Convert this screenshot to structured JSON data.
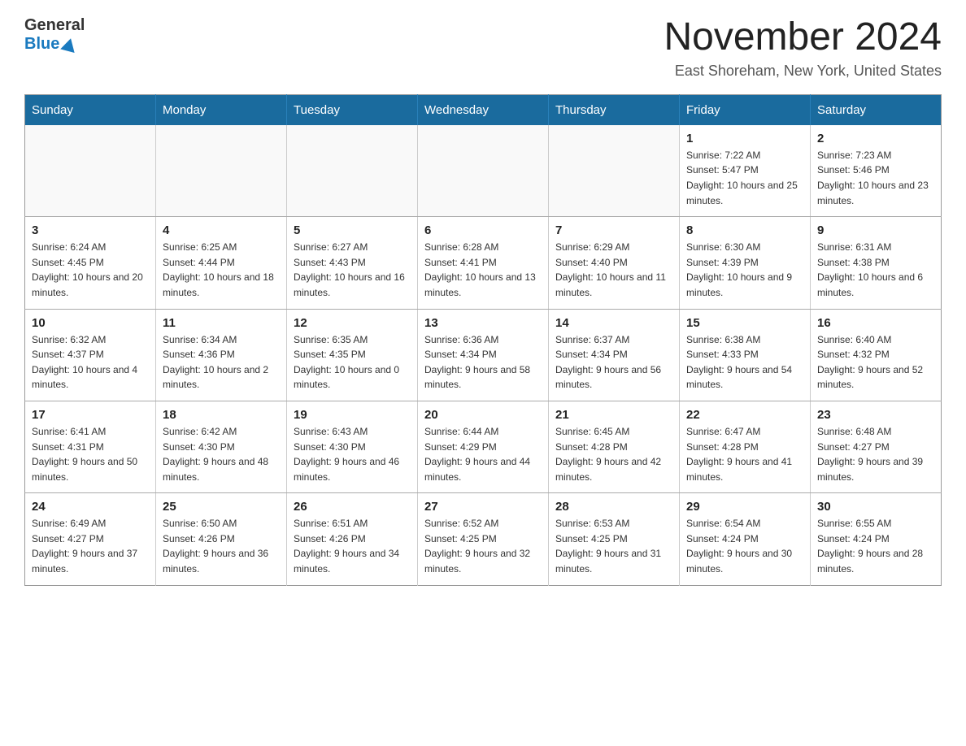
{
  "header": {
    "logo_general": "General",
    "logo_blue": "Blue",
    "month_title": "November 2024",
    "location": "East Shoreham, New York, United States"
  },
  "days_of_week": [
    "Sunday",
    "Monday",
    "Tuesday",
    "Wednesday",
    "Thursday",
    "Friday",
    "Saturday"
  ],
  "weeks": [
    [
      {
        "day": "",
        "info": ""
      },
      {
        "day": "",
        "info": ""
      },
      {
        "day": "",
        "info": ""
      },
      {
        "day": "",
        "info": ""
      },
      {
        "day": "",
        "info": ""
      },
      {
        "day": "1",
        "info": "Sunrise: 7:22 AM\nSunset: 5:47 PM\nDaylight: 10 hours and 25 minutes."
      },
      {
        "day": "2",
        "info": "Sunrise: 7:23 AM\nSunset: 5:46 PM\nDaylight: 10 hours and 23 minutes."
      }
    ],
    [
      {
        "day": "3",
        "info": "Sunrise: 6:24 AM\nSunset: 4:45 PM\nDaylight: 10 hours and 20 minutes."
      },
      {
        "day": "4",
        "info": "Sunrise: 6:25 AM\nSunset: 4:44 PM\nDaylight: 10 hours and 18 minutes."
      },
      {
        "day": "5",
        "info": "Sunrise: 6:27 AM\nSunset: 4:43 PM\nDaylight: 10 hours and 16 minutes."
      },
      {
        "day": "6",
        "info": "Sunrise: 6:28 AM\nSunset: 4:41 PM\nDaylight: 10 hours and 13 minutes."
      },
      {
        "day": "7",
        "info": "Sunrise: 6:29 AM\nSunset: 4:40 PM\nDaylight: 10 hours and 11 minutes."
      },
      {
        "day": "8",
        "info": "Sunrise: 6:30 AM\nSunset: 4:39 PM\nDaylight: 10 hours and 9 minutes."
      },
      {
        "day": "9",
        "info": "Sunrise: 6:31 AM\nSunset: 4:38 PM\nDaylight: 10 hours and 6 minutes."
      }
    ],
    [
      {
        "day": "10",
        "info": "Sunrise: 6:32 AM\nSunset: 4:37 PM\nDaylight: 10 hours and 4 minutes."
      },
      {
        "day": "11",
        "info": "Sunrise: 6:34 AM\nSunset: 4:36 PM\nDaylight: 10 hours and 2 minutes."
      },
      {
        "day": "12",
        "info": "Sunrise: 6:35 AM\nSunset: 4:35 PM\nDaylight: 10 hours and 0 minutes."
      },
      {
        "day": "13",
        "info": "Sunrise: 6:36 AM\nSunset: 4:34 PM\nDaylight: 9 hours and 58 minutes."
      },
      {
        "day": "14",
        "info": "Sunrise: 6:37 AM\nSunset: 4:34 PM\nDaylight: 9 hours and 56 minutes."
      },
      {
        "day": "15",
        "info": "Sunrise: 6:38 AM\nSunset: 4:33 PM\nDaylight: 9 hours and 54 minutes."
      },
      {
        "day": "16",
        "info": "Sunrise: 6:40 AM\nSunset: 4:32 PM\nDaylight: 9 hours and 52 minutes."
      }
    ],
    [
      {
        "day": "17",
        "info": "Sunrise: 6:41 AM\nSunset: 4:31 PM\nDaylight: 9 hours and 50 minutes."
      },
      {
        "day": "18",
        "info": "Sunrise: 6:42 AM\nSunset: 4:30 PM\nDaylight: 9 hours and 48 minutes."
      },
      {
        "day": "19",
        "info": "Sunrise: 6:43 AM\nSunset: 4:30 PM\nDaylight: 9 hours and 46 minutes."
      },
      {
        "day": "20",
        "info": "Sunrise: 6:44 AM\nSunset: 4:29 PM\nDaylight: 9 hours and 44 minutes."
      },
      {
        "day": "21",
        "info": "Sunrise: 6:45 AM\nSunset: 4:28 PM\nDaylight: 9 hours and 42 minutes."
      },
      {
        "day": "22",
        "info": "Sunrise: 6:47 AM\nSunset: 4:28 PM\nDaylight: 9 hours and 41 minutes."
      },
      {
        "day": "23",
        "info": "Sunrise: 6:48 AM\nSunset: 4:27 PM\nDaylight: 9 hours and 39 minutes."
      }
    ],
    [
      {
        "day": "24",
        "info": "Sunrise: 6:49 AM\nSunset: 4:27 PM\nDaylight: 9 hours and 37 minutes."
      },
      {
        "day": "25",
        "info": "Sunrise: 6:50 AM\nSunset: 4:26 PM\nDaylight: 9 hours and 36 minutes."
      },
      {
        "day": "26",
        "info": "Sunrise: 6:51 AM\nSunset: 4:26 PM\nDaylight: 9 hours and 34 minutes."
      },
      {
        "day": "27",
        "info": "Sunrise: 6:52 AM\nSunset: 4:25 PM\nDaylight: 9 hours and 32 minutes."
      },
      {
        "day": "28",
        "info": "Sunrise: 6:53 AM\nSunset: 4:25 PM\nDaylight: 9 hours and 31 minutes."
      },
      {
        "day": "29",
        "info": "Sunrise: 6:54 AM\nSunset: 4:24 PM\nDaylight: 9 hours and 30 minutes."
      },
      {
        "day": "30",
        "info": "Sunrise: 6:55 AM\nSunset: 4:24 PM\nDaylight: 9 hours and 28 minutes."
      }
    ]
  ]
}
